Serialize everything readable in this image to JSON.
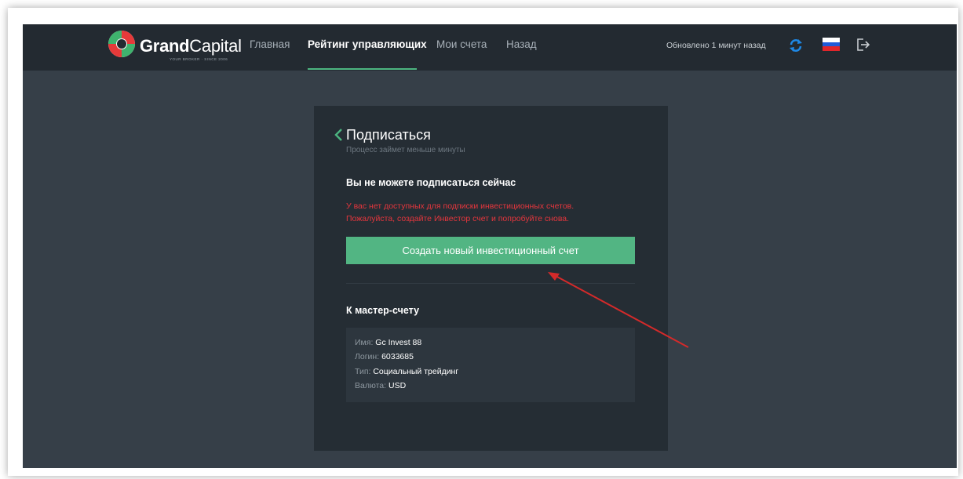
{
  "brand": {
    "name_bold": "Grand",
    "name_light": "Capital",
    "tagline": "YOUR BROKER · SINCE 2006"
  },
  "nav": {
    "items": [
      {
        "label": "Главная",
        "active": false
      },
      {
        "label": "Рейтинг управляющих",
        "active": true
      },
      {
        "label": "Мои счета",
        "active": false
      },
      {
        "label": "Назад",
        "active": false
      }
    ]
  },
  "header": {
    "updated_text": "Обновлено 1 минут назад",
    "icons": [
      "refresh-icon",
      "russian-flag-icon",
      "logout-icon"
    ]
  },
  "card": {
    "title": "Подписаться",
    "subtitle": "Процесс займет меньше минуты",
    "warning_title": "Вы не можете подписаться сейчас",
    "warning_line1": "У вас нет доступных для подписки инвестиционных счетов.",
    "warning_line2": "Пожалуйста, создайте Инвестор счет и попробуйте снова.",
    "cta_label": "Создать новый инвестиционный счет",
    "master_title": "К мастер-счету",
    "master": {
      "name_label": "Имя:",
      "name_value": "Gc Invest 88",
      "login_label": "Логин:",
      "login_value": "6033685",
      "type_label": "Тип:",
      "type_value": "Социальный трейдинг",
      "currency_label": "Валюта:",
      "currency_value": "USD"
    }
  },
  "colors": {
    "accent_green": "#52b583",
    "warning_red": "#e5363d",
    "refresh_blue": "#1e88e5",
    "annotation_arrow": "#d42a2a"
  }
}
